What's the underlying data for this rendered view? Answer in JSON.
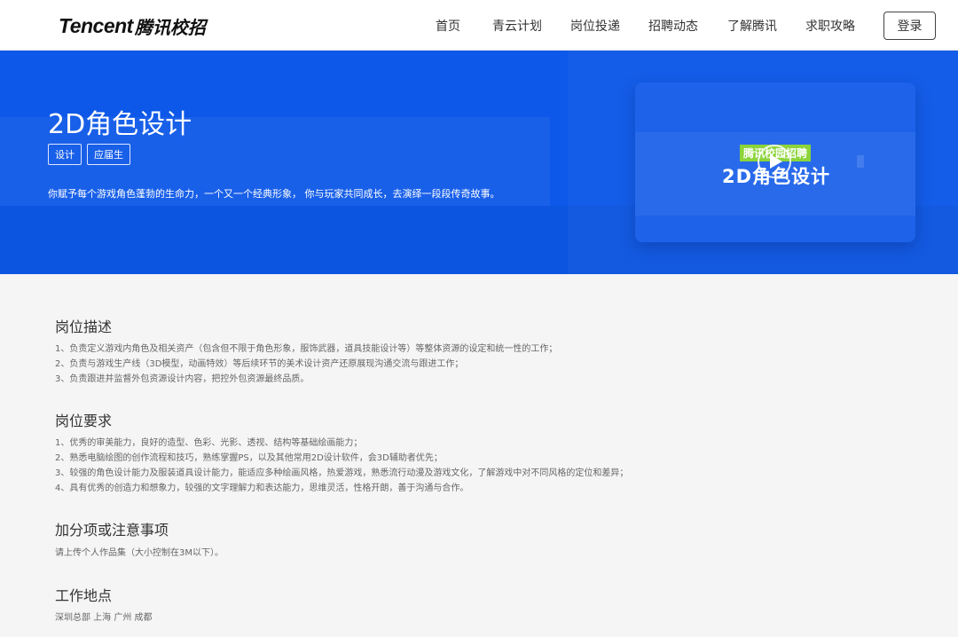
{
  "header": {
    "logo_en": "Tencent",
    "logo_cn": "腾讯校招",
    "nav": [
      {
        "label": "首页"
      },
      {
        "label": "青云计划"
      },
      {
        "label": "岗位投递"
      },
      {
        "label": "招聘动态"
      },
      {
        "label": "了解腾讯"
      },
      {
        "label": "求职攻略"
      }
    ],
    "login_label": "登录"
  },
  "hero": {
    "title": "2D角色设计",
    "tags": [
      "设计",
      "应届生"
    ],
    "description": "你赋予每个游戏角色蓬勃的生命力，一个又一个经典形象， 你与玩家共同成长，去演绎一段段传奇故事。",
    "video": {
      "badge": "腾讯校园招聘",
      "title": "2D角色设计",
      "play_icon": "play-icon"
    }
  },
  "sections": [
    {
      "title": "岗位描述",
      "lines": [
        "1、负责定义游戏内角色及相关资产（包含但不限于角色形象，服饰武器，道具技能设计等）等整体资源的设定和统一性的工作；",
        "2、负责与游戏生产线（3D模型，动画特效）等后续环节的美术设计资产还原展现沟通交流与跟进工作；",
        "3、负责跟进并监督外包资源设计内容，把控外包资源最终品质。"
      ]
    },
    {
      "title": "岗位要求",
      "lines": [
        "1、优秀的审美能力，良好的造型、色彩、光影、透视、结构等基础绘画能力；",
        "2、熟悉电脑绘图的创作流程和技巧，熟练掌握PS，以及其他常用2D设计软件，会3D辅助者优先；",
        "3、较强的角色设计能力及服装道具设计能力，能适应多种绘画风格，热爱游戏，熟悉流行动漫及游戏文化，了解游戏中对不同风格的定位和差异；",
        "4、具有优秀的创造力和想象力，较强的文字理解力和表达能力，思维灵活，性格开朗，善于沟通与合作。"
      ]
    },
    {
      "title": "加分项或注意事项",
      "lines": [
        "请上传个人作品集（大小控制在3M以下）。"
      ]
    },
    {
      "title": "工作地点",
      "lines": [
        "深圳总部 上海 广州 成都"
      ]
    }
  ],
  "colors": {
    "hero_blue": "#0d58e8",
    "badge_green": "#8cd43a",
    "page_bg": "#f5f5f5"
  }
}
